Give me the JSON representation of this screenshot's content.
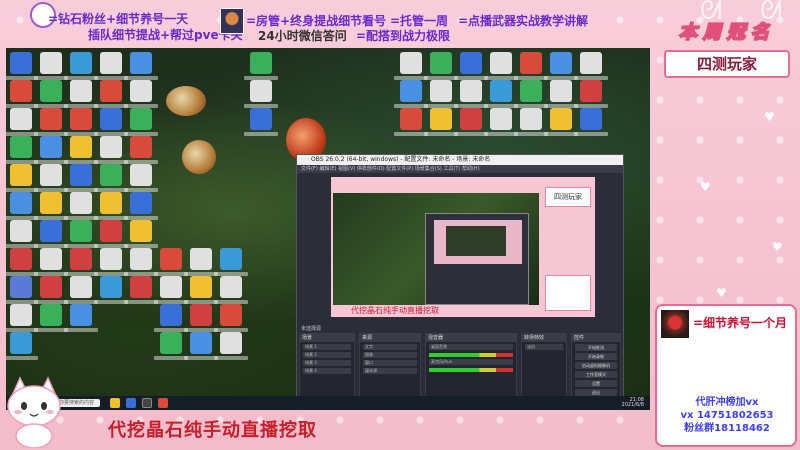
{
  "banner": {
    "line1": "=钻石粉丝+细节养号一天",
    "line2": "插队细节提战+帮过pve卡关",
    "line3": "=房管+终身提战细节看号",
    "line4": "24小时微信答问",
    "line5": "=托管一周",
    "line6": "=点播武器实战教学讲解",
    "line7": "=配搭到战力极限"
  },
  "title_banner": "本周冠名",
  "name_card": "四测玩家",
  "info_panel": {
    "title": "=细节养号一个月",
    "line1": "代肝冲榜加vx",
    "line2": "vx  14751802653",
    "line3": "粉丝群18118462"
  },
  "bottom_caption": "代挖晶石纯手动直播挖取",
  "obs": {
    "window_title": "OBS 26.0.2 (64-bit, windows) - 配置文件: 未命名 - 场景: 未命名",
    "menu": "文件(F)  编辑(E)  视图(V)  停靠部件(D)  配置文件(P)  场景集合(S)  工具(T)  帮助(H)",
    "preview_card": "四测玩家",
    "preview_caption": "代挖晶石纯手动直播挖取",
    "source_label": "未选择源",
    "docks": {
      "scenes": "场景",
      "sources": "来源",
      "mixer": "混音器",
      "transitions": "转场特效",
      "controls": "控件"
    },
    "scene_items": [
      "场景 1",
      "场景 2",
      "场景 3",
      "场景 4"
    ],
    "source_items": [
      "文字",
      "图像",
      "窗口",
      "媒体源"
    ],
    "mixer_items": [
      "桌面音频",
      "麦克风/Aux"
    ],
    "transition_value": "淡出",
    "controls": [
      "开始推流",
      "开始录制",
      "启动虚拟摄像机",
      "工作室模式",
      "设置",
      "退出"
    ]
  },
  "taskbar": {
    "search": "在这里输入你要搜索的内容",
    "time": "21:08",
    "date": "2021/6/8"
  }
}
